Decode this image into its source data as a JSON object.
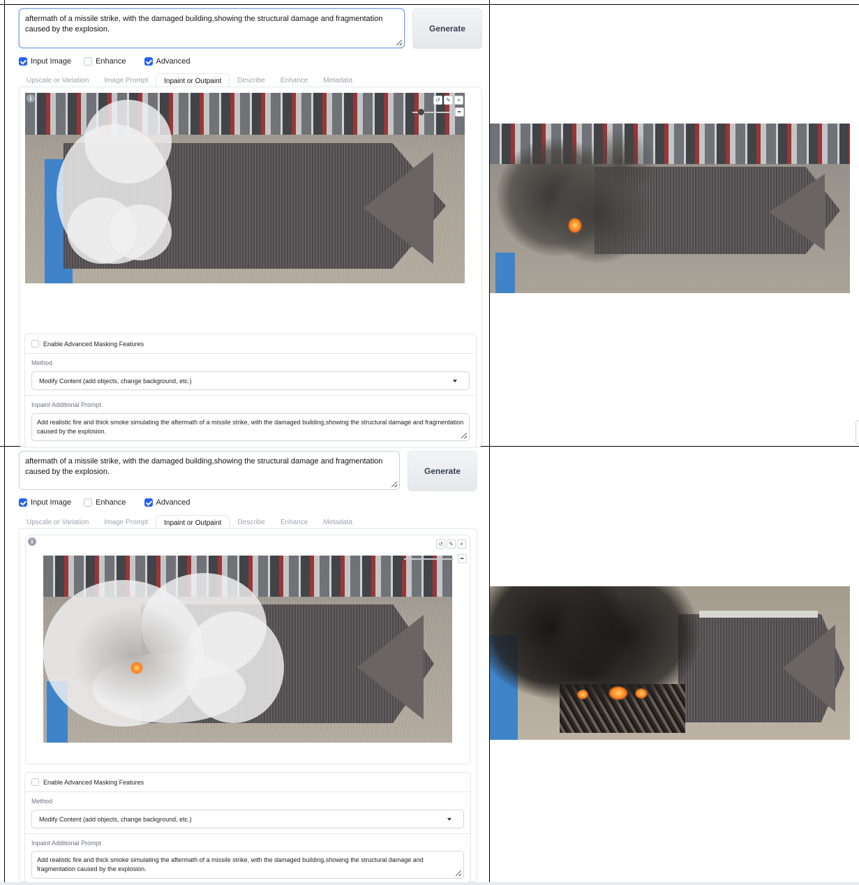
{
  "rows": [
    {
      "prompt_text": "aftermath of a missile strike, with the damaged building,showing the structural damage and fragmentation caused by the explosion.",
      "generate_label": "Generate",
      "checkboxes": [
        {
          "label": "Input Image",
          "checked": true
        },
        {
          "label": "Enhance",
          "checked": false
        },
        {
          "label": "Advanced",
          "checked": true
        }
      ],
      "tabs": [
        "Upscale or Variation",
        "Image Prompt",
        "Inpaint or Outpaint",
        "Describe",
        "Enhance",
        "Metadata"
      ],
      "active_tab": "Inpaint or Outpaint",
      "advanced_masking_label": "Enable Advanced Masking Features",
      "method_label": "Method",
      "method_value": "Modify Content (add objects, change background, etc.)",
      "inpaint_prompt_label": "Inpaint Additional Prompt",
      "inpaint_prompt_value": "Add realistic fire and thick smoke simulating the aftermath of a missile strike, with the damaged building,showing the structural damage and fragmentation caused by the explosion."
    },
    {
      "prompt_text": "aftermath of a missile strike, with the damaged building,showing the structural damage and fragmentation caused by the explosion.",
      "generate_label": "Generate",
      "checkboxes": [
        {
          "label": "Input Image",
          "checked": true
        },
        {
          "label": "Enhance",
          "checked": false
        },
        {
          "label": "Advanced",
          "checked": true
        }
      ],
      "tabs": [
        "Upscale or Variation",
        "Image Prompt",
        "Inpaint or Outpaint",
        "Describe",
        "Enhance",
        "Metadata"
      ],
      "active_tab": "Inpaint or Outpaint",
      "advanced_masking_label": "Enable Advanced Masking Features",
      "method_label": "Method",
      "method_value": "Modify Content (add objects, change background, etc.)",
      "inpaint_prompt_label": "Inpaint Additional Prompt",
      "inpaint_prompt_value": "Add realistic fire and thick smoke simulating the aftermath of a missile strike, with the damaged building,showing the structural damage and fragmentation caused by the explosion."
    }
  ],
  "icons": {
    "info": "i",
    "undo": "↺",
    "brush": "✎",
    "close": "×",
    "pen": "✒"
  },
  "colors": {
    "accent": "#2563eb",
    "border": "#e5e7eb",
    "roof": "#585354",
    "smoke": "#3a3836",
    "fire": "#ff7a1a"
  }
}
